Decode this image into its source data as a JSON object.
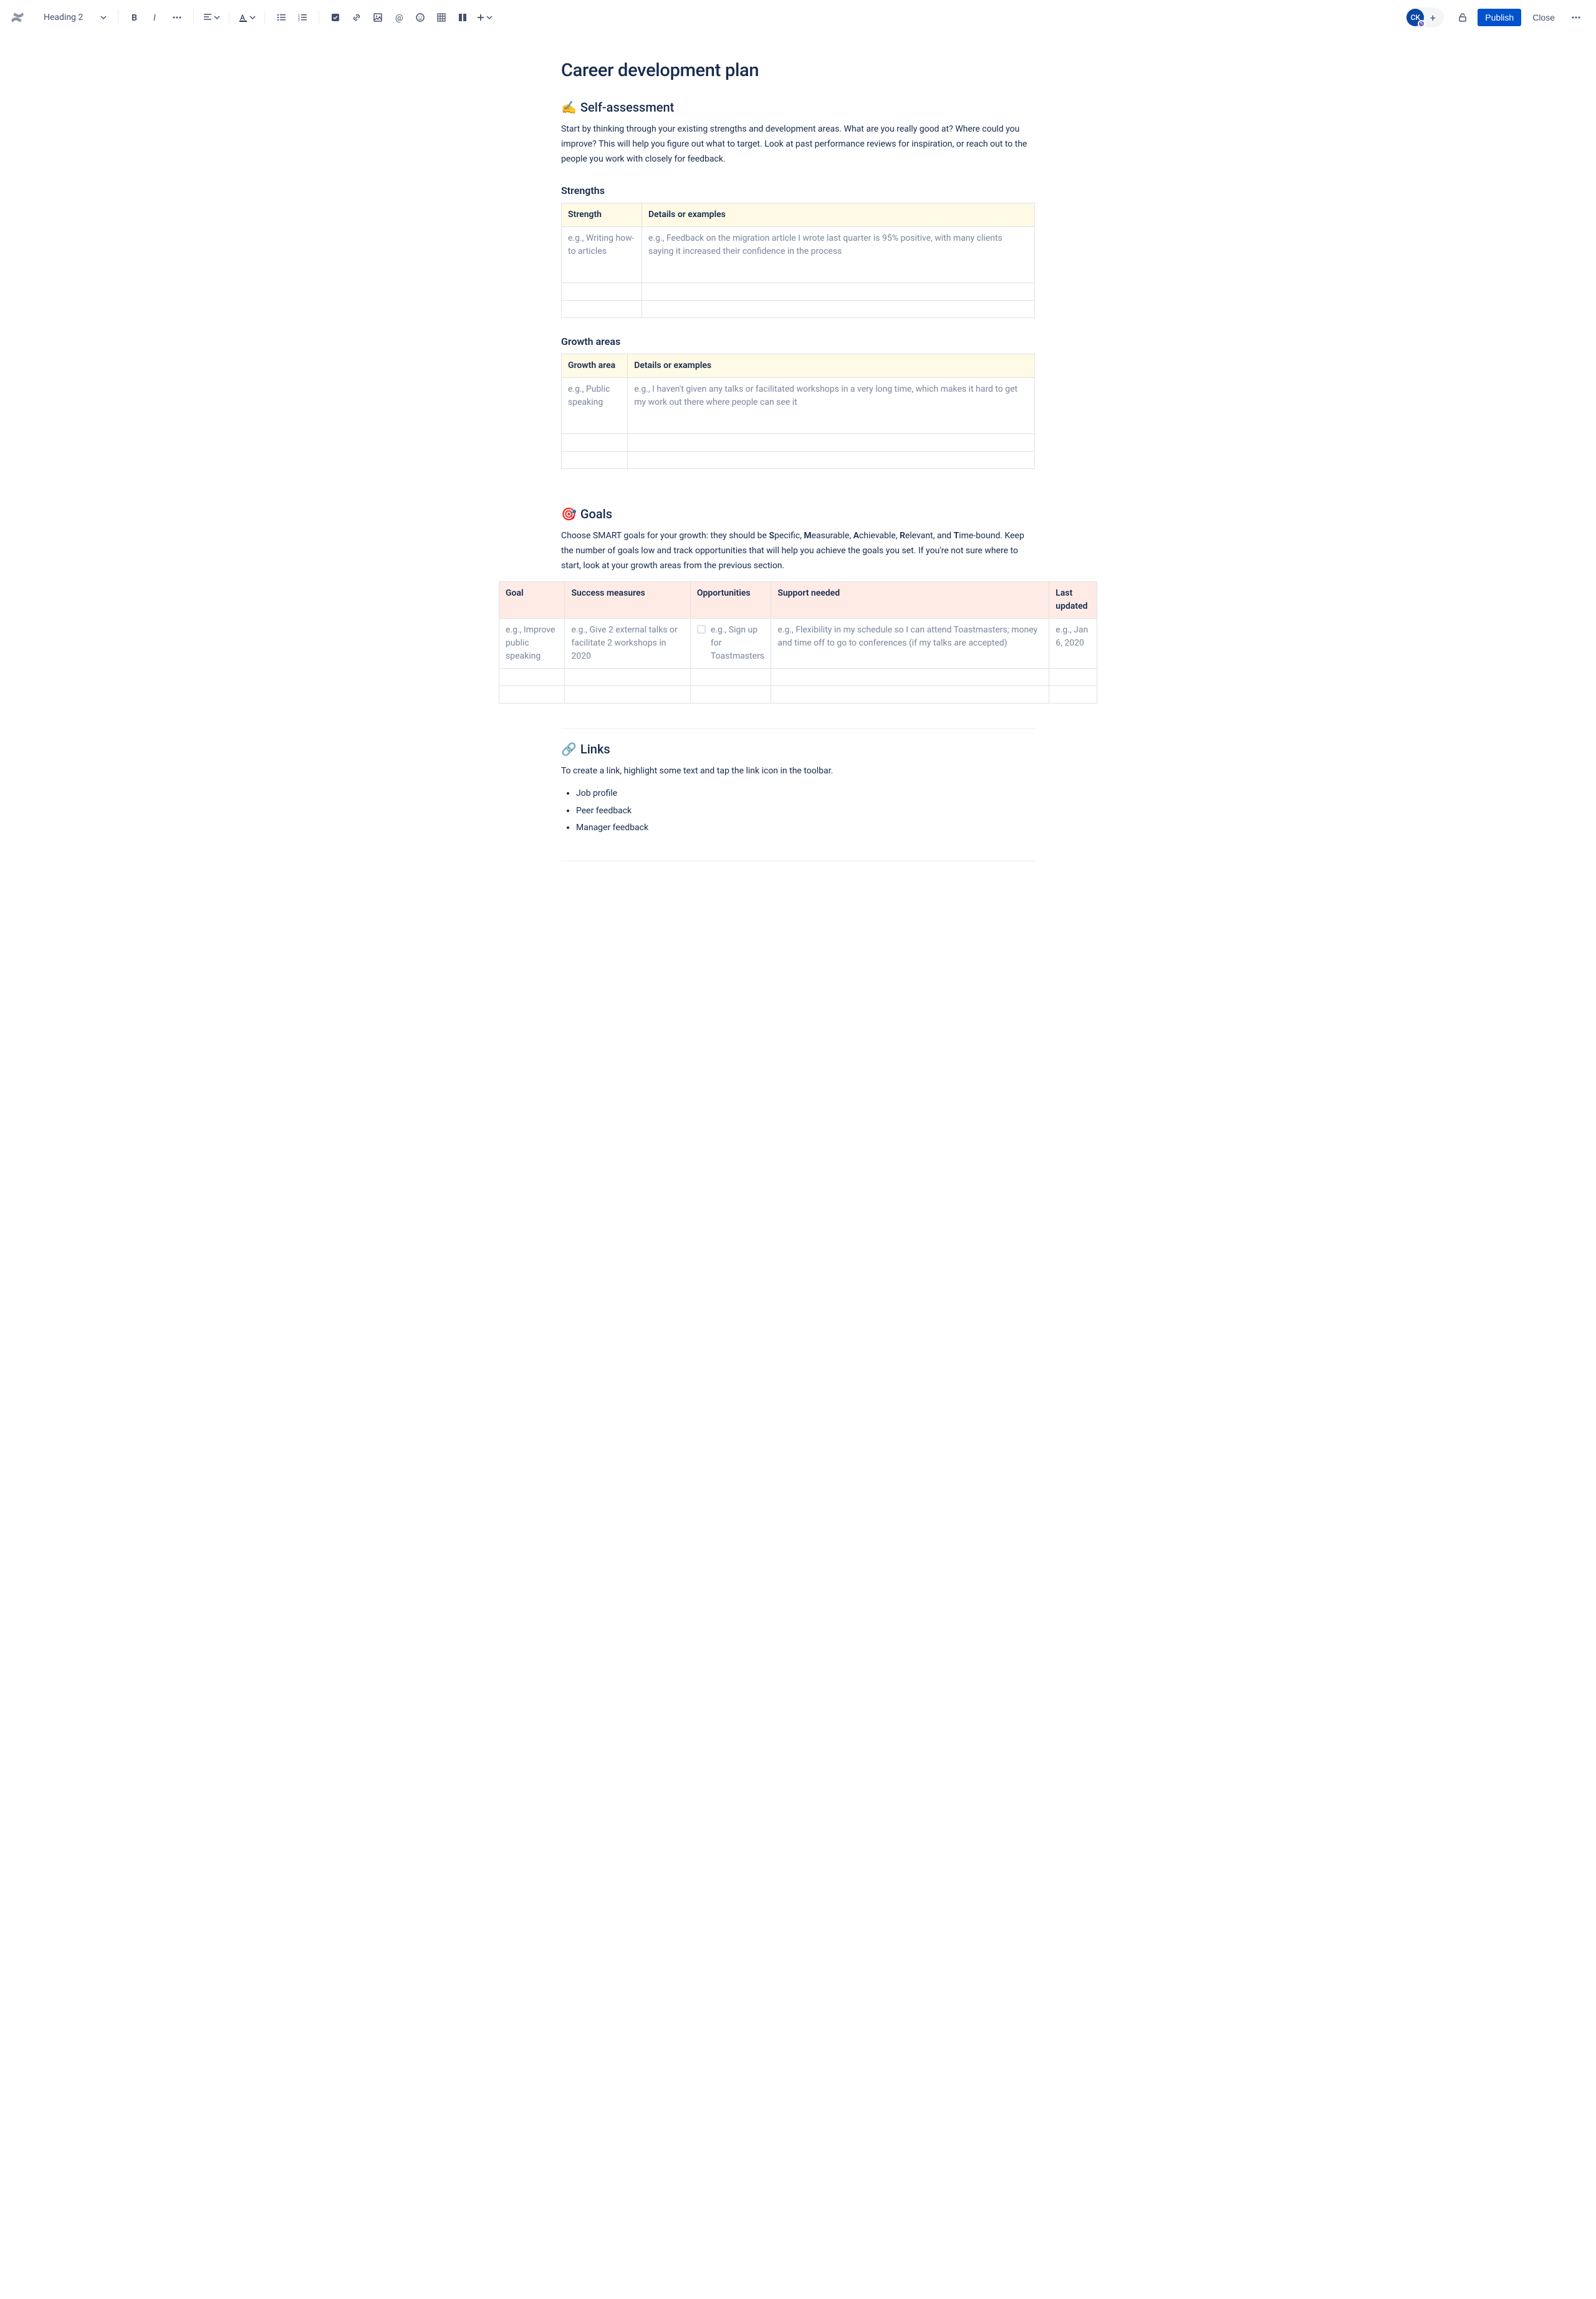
{
  "toolbar": {
    "heading_selector": "Heading 2",
    "publish": "Publish",
    "close": "Close",
    "avatar_initials": "CK"
  },
  "title": "Career development plan",
  "self_assessment": {
    "heading": "Self-assessment",
    "emoji": "✍️",
    "intro": "Start by thinking through your existing strengths and development areas. What are you really good at? Where could you improve? This will help you figure out what to target. Look at past performance reviews for inspiration, or reach out to the people you work with closely for feedback."
  },
  "strengths": {
    "heading": "Strengths",
    "col1": "Strength",
    "col2": "Details or examples",
    "row1_c1": "e.g., Writing how-to articles",
    "row1_c2": "e.g., Feedback on the migration article I wrote last quarter is 95% positive, with many clients saying it increased their confidence in the process"
  },
  "growth": {
    "heading": "Growth areas",
    "col1": "Growth area",
    "col2": "Details or examples",
    "row1_c1": "e.g., Public speaking",
    "row1_c2": "e.g., I haven't given any talks or facilitated workshops in a very long time, which makes it hard to get my work out there where people can see it"
  },
  "goals": {
    "heading": "Goals",
    "emoji": "🎯",
    "intro_pre": "Choose SMART goals for your growth: they should be ",
    "s": "S",
    "s_rest": "pecific, ",
    "m": "M",
    "m_rest": "easurable, ",
    "a": "A",
    "a_rest": "chievable, ",
    "r": "R",
    "r_rest": "elevant, and ",
    "t": "T",
    "t_rest": "ime-bound. Keep the number of goals low and track opportunities that will help you achieve the goals you set. If you're not sure where to start, look at your growth areas from the previous section.",
    "col1": "Goal",
    "col2": "Success measures",
    "col3": "Opportunities",
    "col4": "Support needed",
    "col5": "Last updated",
    "row1_c1": "e.g., Improve public speaking",
    "row1_c2": "e.g., Give 2 external talks or facilitate 2 workshops in 2020",
    "row1_c3": "e.g., Sign up for Toastmasters",
    "row1_c4": "e.g., Flexibility in my schedule so I can attend Toastmasters; money and time off to go to conferences (if my talks are accepted)",
    "row1_c5": "e.g., Jan 6, 2020"
  },
  "links": {
    "heading": "Links",
    "emoji": "🔗",
    "intro": "To create a link, highlight some text and tap the link icon in the toolbar.",
    "items": [
      "Job profile",
      "Peer feedback",
      "Manager feedback"
    ]
  }
}
